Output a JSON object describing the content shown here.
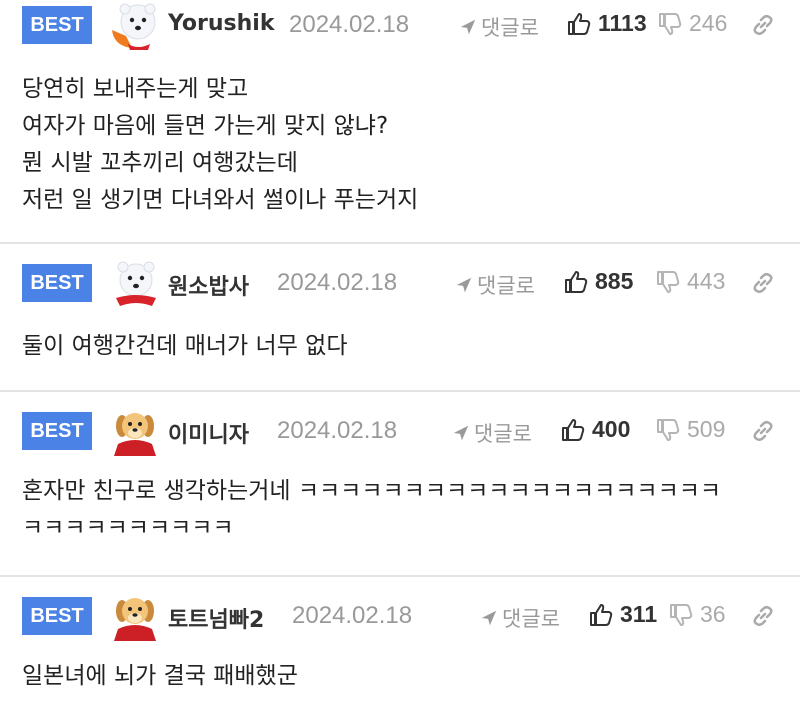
{
  "comments": [
    {
      "badge": "BEST",
      "avatar": "polar-bear",
      "nickname": "Yorushik",
      "date": "2024.02.18",
      "reply_label": "댓글로",
      "likes": "1113",
      "dislikes": "246",
      "lines": [
        "당연히 보내주는게 맞고",
        "여자가 마음에 들면 가는게 맞지 않냐?",
        "뭔 시발 꼬추끼리 여행갔는데",
        "저런 일 생기면 다녀와서 썰이나 푸는거지"
      ]
    },
    {
      "badge": "BEST",
      "avatar": "polar-bear",
      "nickname": "원소밥사",
      "date": "2024.02.18",
      "reply_label": "댓글로",
      "likes": "885",
      "dislikes": "443",
      "lines": [
        "둘이 여행간건데 매너가 너무 없다"
      ]
    },
    {
      "badge": "BEST",
      "avatar": "puppy",
      "nickname": "이미니자",
      "date": "2024.02.18",
      "reply_label": "댓글로",
      "likes": "400",
      "dislikes": "509",
      "lines": [
        "혼자만 친구로 생각하는거네 ㅋㅋㅋㅋㅋㅋㅋㅋㅋㅋㅋㅋㅋㅋㅋㅋㅋㅋㅋㅋ",
        "ㅋㅋㅋㅋㅋㅋㅋㅋㅋㅋ"
      ]
    },
    {
      "badge": "BEST",
      "avatar": "puppy",
      "nickname": "토트넘빠2",
      "date": "2024.02.18",
      "reply_label": "댓글로",
      "likes": "311",
      "dislikes": "36",
      "lines": [
        "일본녀에 뇌가 결국 패배했군"
      ]
    }
  ],
  "icons": {
    "reply": "paper-plane-icon",
    "like": "thumbs-up-icon",
    "dislike": "thumbs-down-icon",
    "link": "link-icon"
  },
  "colors": {
    "badge": "#4a82e6",
    "divider": "#e3e3e3",
    "muted": "#999999"
  }
}
